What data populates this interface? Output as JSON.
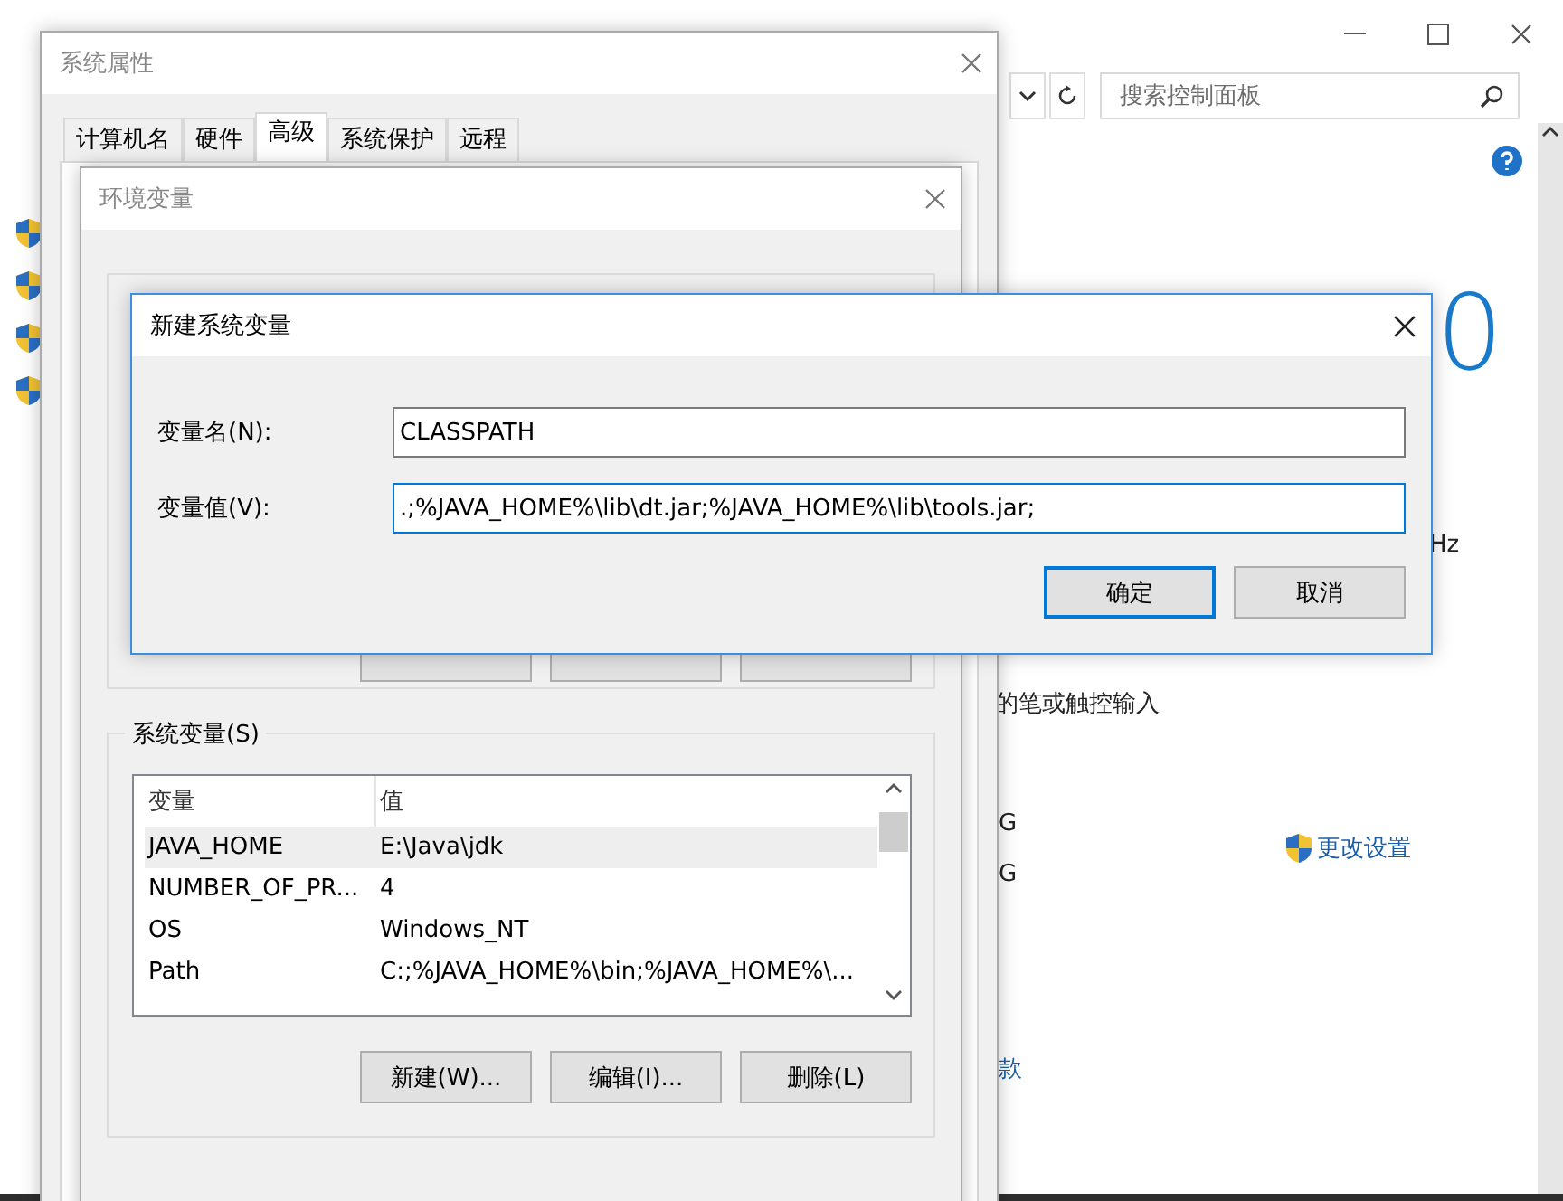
{
  "control_panel": {
    "search": {
      "placeholder": "搜索控制面板"
    },
    "edition_fragment": "0",
    "texts": [
      {
        "text": "Hz",
        "kind": "spec"
      },
      {
        "text": "的笔或触控输入",
        "kind": "spec"
      },
      {
        "text": "G",
        "kind": "name"
      },
      {
        "text": "G",
        "kind": "name"
      }
    ],
    "change_settings": "更改设置",
    "link_fragment": "款"
  },
  "system_properties": {
    "title": "系统属性",
    "tabs": [
      {
        "label": "计算机名",
        "selected": false
      },
      {
        "label": "硬件",
        "selected": false
      },
      {
        "label": "高级",
        "selected": true
      },
      {
        "label": "系统保护",
        "selected": false
      },
      {
        "label": "远程",
        "selected": false
      }
    ]
  },
  "environment_variables": {
    "title": "环境变量",
    "system_variables": {
      "label": "系统变量(S)",
      "columns": [
        "变量",
        "值"
      ],
      "rows": [
        {
          "name": "JAVA_HOME",
          "value": "E:\\Java\\jdk",
          "selected": true
        },
        {
          "name": "NUMBER_OF_PR...",
          "value": "4",
          "selected": false
        },
        {
          "name": "OS",
          "value": "Windows_NT",
          "selected": false
        },
        {
          "name": "Path",
          "value": "C:;%JAVA_HOME%\\bin;%JAVA_HOME%\\...",
          "selected": false
        }
      ]
    },
    "buttons": [
      "新建(W)...",
      "编辑(I)...",
      "删除(L)"
    ]
  },
  "new_variable_dialog": {
    "title": "新建系统变量",
    "fields": [
      {
        "label": "变量名(N):",
        "value": "CLASSPATH",
        "focused": false
      },
      {
        "label": "变量值(V):",
        "value": ".;%JAVA_HOME%\\lib\\dt.jar;%JAVA_HOME%\\lib\\tools.jar;",
        "focused": true
      }
    ],
    "buttons": [
      {
        "label": "确定",
        "default": true
      },
      {
        "label": "取消",
        "default": false
      }
    ]
  }
}
